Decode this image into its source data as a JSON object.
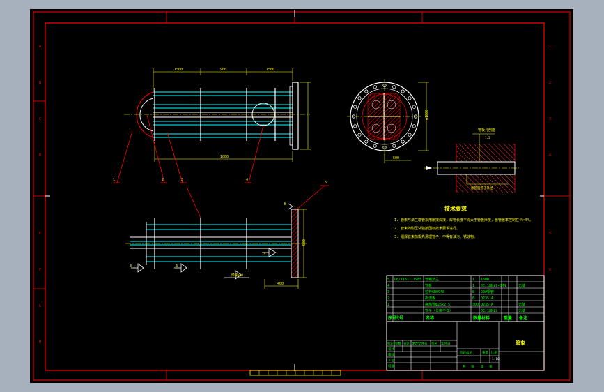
{
  "colors": {
    "window_bg": "#a7b0bd",
    "sheet_bg": "#000000",
    "frame": "#ff0000",
    "outline": "#ffffff",
    "part": "#00ffff",
    "text": "#ffff00",
    "table_text": "#00ff00",
    "hatch": "#ff0000",
    "center_line": "#ffff00"
  },
  "drawing": {
    "title": "技术要求",
    "notes": [
      "1. 管束与法兰端管采用胀接焊接，焊管长度不得大于管板厚度，胀管胀率控制在4%~5%。",
      "2. 管束的耐压试验按国标技术要求进行。",
      "3. 组焊管束前需先清理管子，不得有油污、锈蚀物。"
    ],
    "dimensions": {
      "top_segments": [
        "1500",
        "900",
        "1500"
      ],
      "overall_length": "1000",
      "side_height": "φ1000",
      "side_bottom": "500",
      "front_height": "500",
      "front_bottom": "400",
      "detail_top": "管板孔剖面",
      "detail_sub": "1.5",
      "detail_bottom": "胀管后管子外径"
    },
    "leaders": [
      "1",
      "2",
      "3",
      "4",
      "5"
    ],
    "weld_labels": [
      "3",
      "3",
      "3",
      "焊缝φ10"
    ],
    "detail_mark": "B"
  },
  "parts_table": {
    "rows": [
      {
        "no": "5",
        "code": "GB/T151T-1985",
        "name": "管箱法兰",
        "qty": "1",
        "material": "16MN",
        "weight": "",
        "remark": ""
      },
      {
        "no": "4",
        "code": "",
        "name": "管板",
        "qty": "1",
        "material": "0Cr18Ni9-8MN",
        "weight": "",
        "remark": "无缝"
      },
      {
        "no": "3",
        "code": "",
        "name": "拉杆GB9948",
        "qty": "8",
        "material": "20#钢管",
        "weight": "",
        "remark": ""
      },
      {
        "no": "2",
        "code": "",
        "name": "折流板",
        "qty": "6",
        "material": "Q235-A",
        "weight": "",
        "remark": ""
      },
      {
        "no": "1",
        "code": "",
        "name": "换热管φ25x2.5",
        "qty": "300",
        "material": "Q235-A",
        "weight": "",
        "remark": "无缝"
      },
      {
        "no": "",
        "code": "",
        "name": "管子（长度不详）",
        "qty": "",
        "material": "0Cr18Ni9",
        "weight": "",
        "remark": "无缝"
      }
    ],
    "header": [
      "序号",
      "代号",
      "名称",
      "数量",
      "材料",
      "重量",
      "备注"
    ]
  },
  "title_block": {
    "drawing_name": "管束",
    "scale": "1:10",
    "labels": [
      "标记",
      "处数",
      "分区",
      "更改文件号",
      "签名",
      "年月日"
    ],
    "stage_labels": [
      "阶段标记",
      "重量",
      "比例"
    ],
    "sign_labels": [
      "设计",
      "审核",
      "工艺",
      "批准"
    ],
    "sheet_labels": [
      "共",
      "张",
      "第",
      "张"
    ]
  }
}
